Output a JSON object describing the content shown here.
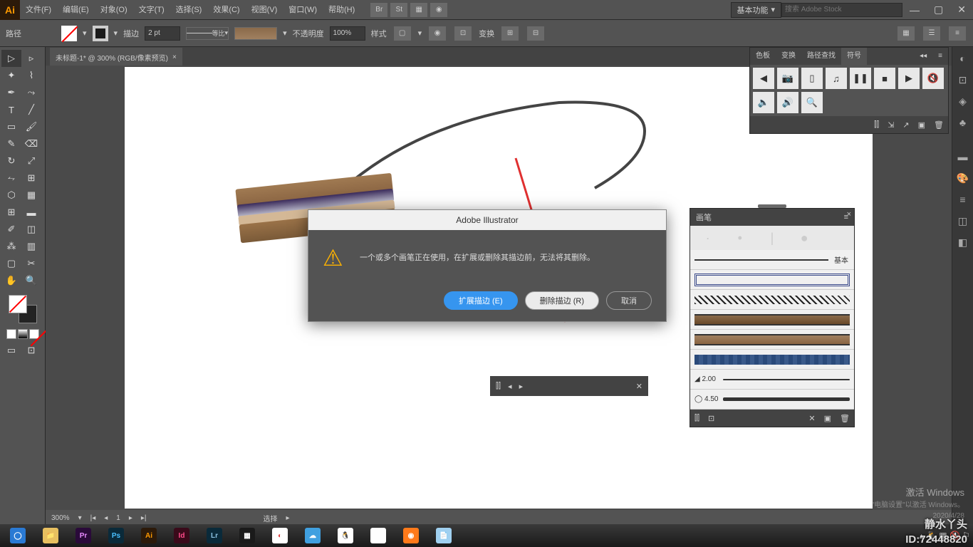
{
  "app": {
    "logo": "Ai"
  },
  "menu": {
    "file": "文件(F)",
    "edit": "编辑(E)",
    "object": "对象(O)",
    "type": "文字(T)",
    "select": "选择(S)",
    "effect": "效果(C)",
    "view": "视图(V)",
    "window": "窗口(W)",
    "help": "帮助(H)",
    "workspace": "基本功能",
    "search_placeholder": "搜索 Adobe Stock"
  },
  "controlbar": {
    "path": "路径",
    "stroke": "描边",
    "stroke_value": "2 pt",
    "profile": "等比",
    "opacity_label": "不透明度",
    "opacity_value": "100%",
    "style": "样式",
    "transform": "变换"
  },
  "doc": {
    "tab_title": "未标题-1* @ 300% (RGB/像素预览)",
    "close": "×"
  },
  "status": {
    "zoom": "300%",
    "selection": "选择"
  },
  "panel_top": {
    "tabs": [
      "色板",
      "变换",
      "路径查找",
      "符号"
    ]
  },
  "brush_panel": {
    "title": "画笔",
    "basic": "基本",
    "brushes": [
      {
        "label": "",
        "type": "border"
      },
      {
        "label": "",
        "type": "wavy"
      },
      {
        "label": "",
        "type": "rail"
      },
      {
        "label": "",
        "type": "rail2"
      },
      {
        "label": "",
        "type": "blue"
      },
      {
        "label": "2.00",
        "type": "thick"
      },
      {
        "label": "4.50",
        "type": "thick"
      }
    ]
  },
  "dialog": {
    "title": "Adobe Illustrator",
    "message": "一个或多个画笔正在使用，在扩展或删除其描边前，无法将其删除。",
    "expand": "扩展描边 (E)",
    "remove": "删除描边 (R)",
    "cancel": "取消"
  },
  "watermark": {
    "line1": "激活 Windows",
    "line2": "转到\"电脑设置\"以激活 Windows。",
    "name": "静水丫头",
    "id": "ID:72448820",
    "date": "2020/4/28"
  }
}
